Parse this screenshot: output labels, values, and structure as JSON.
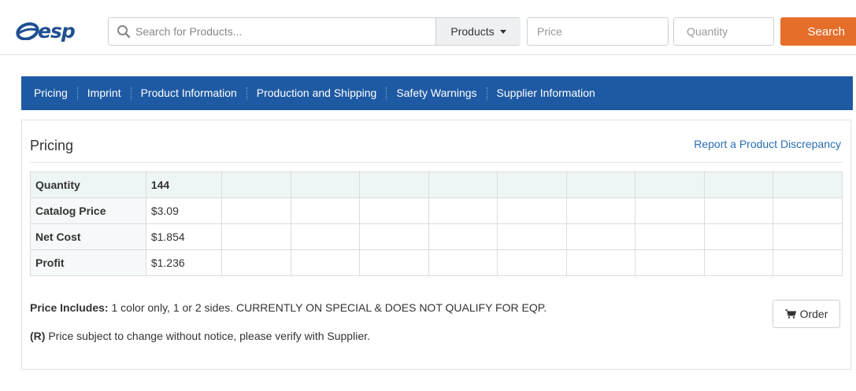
{
  "header": {
    "logo_text": "esp",
    "search_placeholder": "Search for Products...",
    "scope_label": "Products",
    "price_placeholder": "Price",
    "quantity_placeholder": "Quantity",
    "search_button": "Search",
    "accent_color": "#e46e2a",
    "brand_color": "#1f4f91"
  },
  "tabs": [
    {
      "label": "Pricing"
    },
    {
      "label": "Imprint"
    },
    {
      "label": "Product Information"
    },
    {
      "label": "Production and Shipping"
    },
    {
      "label": "Safety Warnings"
    },
    {
      "label": "Supplier Information"
    }
  ],
  "pricing": {
    "title": "Pricing",
    "report_link": "Report a Product Discrepancy",
    "rows": [
      {
        "label": "Quantity",
        "value": "144"
      },
      {
        "label": "Catalog Price",
        "value": "$3.09"
      },
      {
        "label": "Net Cost",
        "value": "$1.854"
      },
      {
        "label": "Profit",
        "value": "$1.236"
      }
    ],
    "includes_label": "Price Includes:",
    "includes_text": " 1 color only, 1 or 2 sides. CURRENTLY ON SPECIAL & DOES NOT QUALIFY FOR EQP.",
    "notice_code": "(R)",
    "notice_text": " Price subject to change without notice, please verify with Supplier.",
    "order_button": "Order"
  }
}
